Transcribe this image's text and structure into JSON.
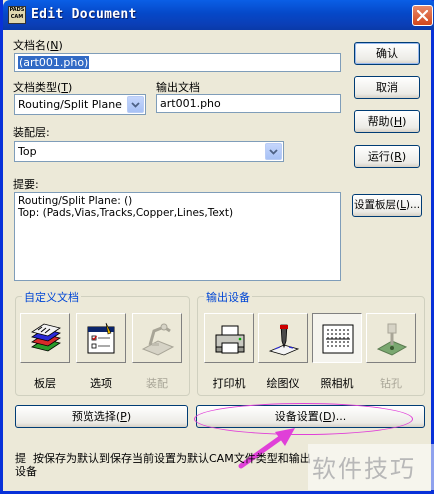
{
  "window": {
    "title": "Edit Document",
    "icon_text": "PADS CAM"
  },
  "colors": {
    "title_blue": "#0548c8",
    "selection": "#316ac5",
    "group_title": "#0046d5",
    "highlight_ellipse": "#e040d8",
    "arrow": "#e040d8"
  },
  "form": {
    "doc_name_label": "文档名(",
    "doc_name_key": "N",
    "doc_name_label_end": ")",
    "doc_name_value": "(art001.pho)",
    "doc_type_label": "文档类型(",
    "doc_type_key": "T",
    "doc_type_label_end": ")",
    "doc_type_value": "Routing/Split Plane",
    "output_label": "输出文档",
    "output_value": "art001.pho",
    "layer_label": "装配层:",
    "layer_value": "Top",
    "summary_label": "提要:",
    "summary_lines": [
      "Routing/Split Plane: ()",
      "Top: (Pads,Vias,Tracks,Copper,Lines,Text)"
    ]
  },
  "buttons": {
    "ok": "确认",
    "cancel": "取消",
    "help": "帮助(",
    "help_key": "H",
    "help_end": ")",
    "run": "运行(",
    "run_key": "R",
    "run_end": ")",
    "layers": "设置板层(",
    "layers_key": "L",
    "layers_end": ")...",
    "preview": "预览选择(",
    "preview_key": "P",
    "preview_end": ")",
    "device_setup": "设备设置(",
    "device_setup_key": "D",
    "device_setup_end": ")..."
  },
  "custom_group": {
    "title": "自定义文档",
    "items": [
      {
        "label": "板层",
        "icon": "layers-icon",
        "enabled": true
      },
      {
        "label": "选项",
        "icon": "options-icon",
        "enabled": true
      },
      {
        "label": "装配",
        "icon": "assembly-icon",
        "enabled": false
      }
    ]
  },
  "device_group": {
    "title": "输出设备",
    "items": [
      {
        "label": "打印机",
        "icon": "printer-icon",
        "enabled": true
      },
      {
        "label": "绘图仪",
        "icon": "plotter-icon",
        "enabled": true
      },
      {
        "label": "照相机",
        "icon": "photoplotter-icon",
        "enabled": true,
        "selected": true
      },
      {
        "label": "钻孔",
        "icon": "drill-icon",
        "enabled": false
      }
    ]
  },
  "status": {
    "prefix": "提",
    "text": "按保存为默认到保存当前设置为默认CAM文件类型和输出设备"
  },
  "watermark": "软件技巧"
}
